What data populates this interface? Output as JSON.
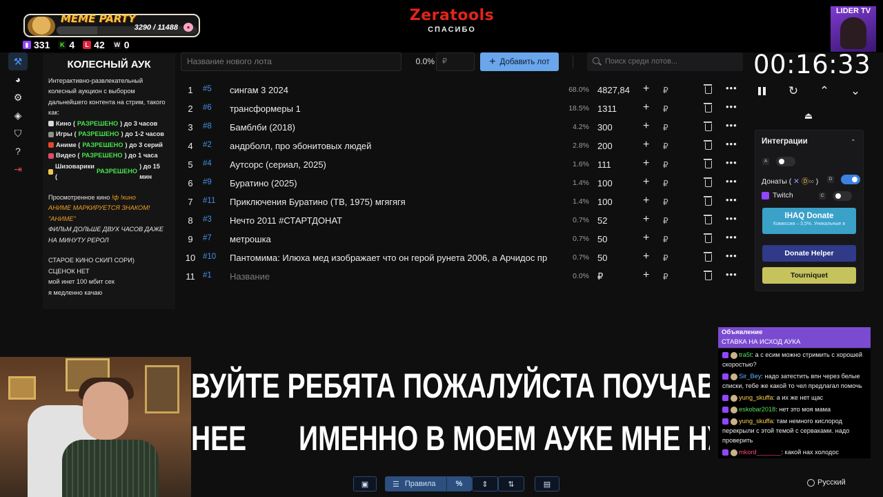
{
  "overlay": {
    "meme_title": "MEME PARTY",
    "meme_count": "3290 / 11488",
    "meme_progress": 0.29,
    "stats": [
      {
        "icon": "twitch-icon",
        "value": "331",
        "color": "#9146ff"
      },
      {
        "icon": "kick-icon",
        "value": "4",
        "color": "#53fc18"
      },
      {
        "icon": "vk-live-icon",
        "value": "42",
        "color": "#e0203a"
      },
      {
        "icon": "wasd-icon",
        "value": "0",
        "color": "#ffffff"
      }
    ],
    "brand": "Zeratools",
    "brand_sub": "СПАСИБО",
    "channel": "LIDER TV"
  },
  "rules": {
    "title": "КОЛЕСНЫЙ АУК",
    "intro": "Интерактивно-развлекательный колесный аукцион с выбором дальнейшего контента на стрим, такого как:",
    "items": [
      {
        "prefix": "Кино (",
        "allowed": "РАЗРЕШЕНО",
        "suffix": ") до 3 часов",
        "emoji_color": "#d9d9d9"
      },
      {
        "prefix": "Игры (",
        "allowed": "РАЗРЕШЕНО",
        "suffix": ") до 1-2 часов",
        "emoji_color": "#8f8f8f"
      },
      {
        "prefix": "Аниме (",
        "allowed": "РАЗРЕШЕНО",
        "suffix": ") до 3 серий",
        "emoji_color": "#e0472e"
      },
      {
        "prefix": "Видео (",
        "allowed": "РАЗРЕШЕНО",
        "suffix": ") до 1 часа",
        "emoji_color": "#e04a6a"
      },
      {
        "prefix": "Шизоварики (",
        "allowed": "РАЗРЕШЕНО",
        "suffix": ") до 15 мин",
        "emoji_color": "#f2c94c"
      }
    ],
    "watched_prefix": "Просмотренное кино ",
    "watched_cmd": "!ф !кино",
    "anime_note_1": "АНИМЕ МАРКИРУЕТСЯ ЗНАКОМ!",
    "anime_note_2": "\"АНИМЕ\"",
    "long_film": "ФИЛЬМ ДОЛЬШЕ ДВУХ ЧАСОВ ДАЖЕ НА МИНУТУ РЕРОЛ",
    "old_cinema": "СТАРОЕ КИНО СКИП СОРИ)",
    "no_rating": "СЦЕНОК НЕТ",
    "internet": "мой инет 100 мбит сек",
    "slow": "я медленно качаю"
  },
  "controls": {
    "new_lot_placeholder": "Название нового лота",
    "percent": "0.0%",
    "amount_placeholder": "₽",
    "add_label": "Добавить лот",
    "search_placeholder": "Поиск среди лотов..."
  },
  "lots": [
    {
      "n": "1",
      "id": "#5",
      "name": "сингам 3 2024",
      "pct": "68.0%",
      "amount": "4827,84"
    },
    {
      "n": "2",
      "id": "#6",
      "name": "трансформеры 1",
      "pct": "18.5%",
      "amount": "1311"
    },
    {
      "n": "3",
      "id": "#8",
      "name": "Бамблби (2018)",
      "pct": "4.2%",
      "amount": "300"
    },
    {
      "n": "4",
      "id": "#2",
      "name": "андрболл, про эбонитовых людей",
      "pct": "2.8%",
      "amount": "200"
    },
    {
      "n": "5",
      "id": "#4",
      "name": "Аутсорс (сериал, 2025)",
      "pct": "1.6%",
      "amount": "111"
    },
    {
      "n": "6",
      "id": "#9",
      "name": "Буратино (2025)",
      "pct": "1.4%",
      "amount": "100"
    },
    {
      "n": "7",
      "id": "#11",
      "name": "Приключения Буратино (ТВ, 1975) мгягягя",
      "pct": "1.4%",
      "amount": "100"
    },
    {
      "n": "8",
      "id": "#3",
      "name": "Нечто 2011 #СТАРТДОНАТ",
      "pct": "0.7%",
      "amount": "52"
    },
    {
      "n": "9",
      "id": "#7",
      "name": "метрошка",
      "pct": "0.7%",
      "amount": "50"
    },
    {
      "n": "10",
      "id": "#10",
      "name": "Пантомима: Илюха мед изображает что он герой рунета 2006, а Арчидос пр",
      "pct": "0.7%",
      "amount": "50"
    },
    {
      "n": "11",
      "id": "#1",
      "name": "Название",
      "pct": "0.0%",
      "amount": "₽",
      "placeholder": true
    }
  ],
  "currency": "₽",
  "timer": {
    "value": "00:16:33"
  },
  "integrations": {
    "title": "Интеграции",
    "key_a": "A",
    "donates_label": "Донаты (",
    "key_d": "D",
    "twitch_label": "Twitch",
    "key_c": "C",
    "ihaq_title": "IHAQ Donate",
    "ihaq_sub": "Комиссия – 3,5%. Уникальные в",
    "donate_helper": "Donate Helper",
    "tourniquet": "Tourniquet"
  },
  "chat": {
    "announce_title": "Объявление",
    "announce_text": "СТАВКА НА ИСХОД АУКА",
    "messages": [
      {
        "user": "tra5t",
        "text": "а с есим можно стримить с хорошей скоростью?",
        "cls": "u3"
      },
      {
        "user": "Sir_Bey",
        "text": "надо затестить впн через белые списки, тебе же какой то чел предлагал помочь",
        "cls": "u1"
      },
      {
        "user": "yung_skuffa",
        "text": "а их же нет щас",
        "cls": "u2"
      },
      {
        "user": "eskobar2018",
        "text": "нет это моя мама",
        "cls": "u3"
      },
      {
        "user": "yung_skuffa",
        "text": "там немного кислород перекрыли с этой темой с серваками. надо проверить",
        "cls": "u2"
      },
      {
        "user": "mkord_______",
        "text": "какой нах холодос",
        "cls": "u4"
      }
    ]
  },
  "language": "Русский",
  "marquee": {
    "line1": "ВУЙТЕ РЕБЯТА ПОЖАЛУЙСТА ПОУЧАВСТ",
    "line2": "НЕЕ       ИМЕННО В МОЕМ АУКЕ МНЕ НУЖН"
  },
  "toolbar": {
    "rules_label": "Правила",
    "percent_symbol": "%"
  }
}
